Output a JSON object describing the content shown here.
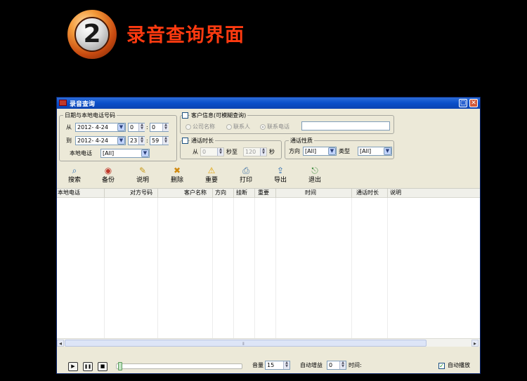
{
  "banner": {
    "number": "2",
    "title": "录音查询界面"
  },
  "window": {
    "title": "录音查询",
    "minimize_glyph": "▢",
    "close_glyph": "✕"
  },
  "date_group": {
    "legend": "日期与本地电话号码",
    "from_label": "从",
    "from_date": "2012- 4-24",
    "from_hour": "0",
    "from_minute": "0",
    "to_label": "到",
    "to_date": "2012- 4-24",
    "to_hour": "23",
    "to_minute": "59",
    "time_sep": ":",
    "local_phone_label": "本地电话",
    "local_phone_value": "[All]"
  },
  "customer_group": {
    "legend": "客户信息(可模糊查询)",
    "opt_company": "公司名称",
    "opt_contact": "联系人",
    "opt_phone": "联系电话",
    "search_value": ""
  },
  "duration_group": {
    "legend": "通话时长",
    "from_label": "从",
    "from_value": "0",
    "sec_to_label": "秒至",
    "to_value": "120",
    "sec_label": "秒"
  },
  "call_prop_group": {
    "legend": "通话性质",
    "direction_label": "方向",
    "direction_value": "[All]",
    "type_label": "类型",
    "type_value": "[All]"
  },
  "toolbar": {
    "search": "搜索",
    "backup": "备份",
    "note": "说明",
    "delete": "删除",
    "important": "重要",
    "print": "打印",
    "export": "导出",
    "exit": "退出"
  },
  "table": {
    "columns": [
      "本地电话",
      "对方号码",
      "客户名称",
      "方向",
      "挂断",
      "重要",
      "时间",
      "通话时长",
      "说明"
    ]
  },
  "player": {
    "play_glyph": "▶",
    "pause_glyph": "❚❚",
    "stop_glyph": "■",
    "volume_label": "音量",
    "volume_value": "15",
    "auto_gain_label": "自动增益",
    "auto_gain_value": "0",
    "time_label": "时间:",
    "autoplay_label": "自动播放",
    "autoplay_checked": true
  }
}
